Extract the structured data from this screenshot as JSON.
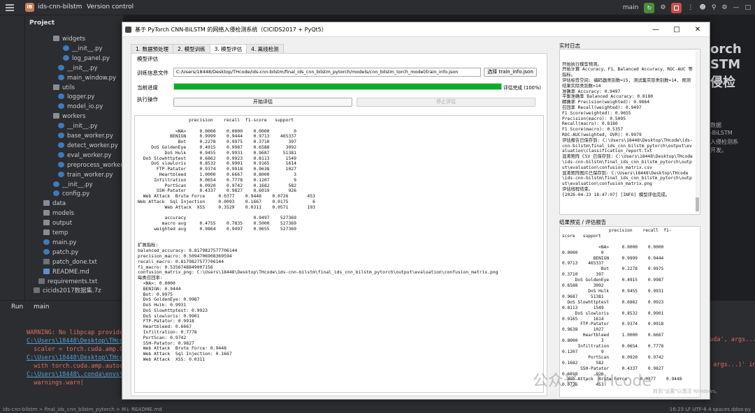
{
  "ide": {
    "project_badge": "IB",
    "project_name": "ids-cnn-bilstm",
    "version_control": "Version control",
    "branch": "main",
    "project_panel_title": "Project",
    "tree": [
      {
        "label": "widgets",
        "type": "folder",
        "indent": 2
      },
      {
        "label": "__init__.py",
        "type": "py",
        "indent": 4
      },
      {
        "label": "log_panel.py",
        "type": "py",
        "indent": 4
      },
      {
        "label": "__init__.py",
        "type": "py",
        "indent": 3
      },
      {
        "label": "main_window.py",
        "type": "py",
        "indent": 3
      },
      {
        "label": "utils",
        "type": "folder",
        "indent": 2
      },
      {
        "label": "logger.py",
        "type": "py",
        "indent": 3
      },
      {
        "label": "model_io.py",
        "type": "py",
        "indent": 3
      },
      {
        "label": "workers",
        "type": "folder",
        "indent": 2
      },
      {
        "label": "__init__.py",
        "type": "py",
        "indent": 3
      },
      {
        "label": "base_worker.py",
        "type": "py",
        "indent": 3
      },
      {
        "label": "detect_worker.py",
        "type": "py",
        "indent": 3
      },
      {
        "label": "eval_worker.py",
        "type": "py",
        "indent": 3
      },
      {
        "label": "preprocess_worker.py",
        "type": "py",
        "indent": 3
      },
      {
        "label": "train_worker.py",
        "type": "py",
        "indent": 3
      },
      {
        "label": "__init__.py",
        "type": "py",
        "indent": 2
      },
      {
        "label": "config.py",
        "type": "py",
        "indent": 2
      },
      {
        "label": "data",
        "type": "folder",
        "indent": 0
      },
      {
        "label": "models",
        "type": "folder",
        "indent": 0
      },
      {
        "label": "output",
        "type": "folder",
        "indent": 0
      },
      {
        "label": "temp",
        "type": "folder",
        "indent": 0
      },
      {
        "label": "main.py",
        "type": "py",
        "indent": 0
      },
      {
        "label": "patch.py",
        "type": "py",
        "indent": 0
      },
      {
        "label": "patch_done.txt",
        "type": "txt",
        "indent": 0
      },
      {
        "label": "README.md",
        "type": "md",
        "indent": 0
      },
      {
        "label": "requirements.txt",
        "type": "txt",
        "indent": -1
      },
      {
        "label": "cicids2017数据集.7z",
        "type": "txt",
        "indent": -2
      }
    ],
    "run_label": "Run",
    "run_tab": "main",
    "run_output": [
      {
        "cls": "w",
        "text": "WARNING: No libpcap provider"
      },
      {
        "cls": "l",
        "text": "C:\\Users\\18448\\Desktop\\THcode"
      },
      {
        "cls": "w",
        "text": "  scaler = torch.cuda.amp.Gra"
      },
      {
        "cls": "l",
        "text": "C:\\Users\\18448\\Desktop\\THcode"
      },
      {
        "cls": "w",
        "text": "  with torch.cuda.amp.autocas"
      },
      {
        "cls": "l",
        "text": "C:\\Users\\18448\\.conda\\envs\\d"
      },
      {
        "cls": "w",
        "text": "  warnings.warn("
      }
    ],
    "run_output_right": "cuda', args...\n\n\n, args...)' in",
    "status_left": "ids-cnn-bilstm  >  final_ids_cnn_bilstm_pytorch  >  M↓ README.md",
    "status_right": "16:23   LF   UTF-8   4 spaces   ddos-py",
    "bg_right_text": [
      "orch",
      "STM",
      "侵检",
      "",
      "",
      "",
      "",
      "数据",
      "-BiLSTM",
      "入侵检测系",
      "开发。"
    ]
  },
  "window": {
    "title": "基于 PyTorch CNN-BiLSTM 的网络入侵检测系统（CICIDS2017 + PyQt5）",
    "tabs": [
      "1. 数据预处理",
      "2. 模型训练",
      "3. 模型评估",
      "4. 离线检测"
    ],
    "active_tab": 2,
    "group_title": "模型评估",
    "train_info_label": "训练信息文件",
    "train_info_path": "C:/Users/18448/Desktop/THcode/ids-cnn-bilstm/final_ids_cnn_bilstm_pytorch/models/cnn_bilstm_torch_model/train_info.json",
    "choose_button": "选择 train_info.json",
    "progress_label": "当前进度",
    "progress_value": 1.0,
    "progress_text": "评估完成 (100%)",
    "actions_label": "执行操作",
    "start_button": "开始评估",
    "stop_button": "停止评估",
    "report_text": "                   precision    recall  f1-score   support\n\n              <NA>     0.0000    0.0000    0.0000         0\n            BENIGN     0.9999    0.9444    0.9713    465337\n               Bot     0.2278    0.9975    0.3710       397\n     DoS GoldenEye     0.4915    0.9987    0.6588      3092\n          DoS Hulk     0.9455    0.9931    0.9687     51381\n  DoS Slowhttptest     0.6862    0.9923    0.8113      1549\n     DoS slowloris     0.8532    0.9901    0.9165      1614\n       FTP-Patator     0.9374    0.9918    0.9638      1027\n        Heartbleed     1.0000    0.6667    0.8000         3\n      Infiltration     0.0654    0.7778    0.1207         9\n          PortScan     0.0920    0.9742    0.1682       582\n       SSH-Patator     0.4337    0.9827    0.6019       926\n  Web Attack  Brute Force     0.0377    0.9448    0.0726       453\nWeb Attack  Sql Injection     0.0093    0.1667    0.0175         6\n          Web Attack  XSS     0.3529    0.0311    0.0571       193\n\n          accuracy                         0.9497    527369\n         macro avg     0.4755    0.7835    0.5000    527369\n      weighted avg     0.9864    0.9497    0.9655    527369\n\n\n扩展指标:\nbalanced_accuracy: 0.8179827577706144\nprecision_macro: 0.5094706908369594\nrecall_macro: 0.8179827577706144\nf1_macro: 0.5356748849007156\nconfusion_matrix_png: C:\\Users\\18448\\Desktop\\THcode\\ids-cnn-bilstm\\final_ids_cnn_bilstm_pytorch\\output\\evaluation\\confusion_matrix.png\n每类召回率:\n  <NA>: 0.0000\n  BENIGN: 0.9444\n  Bot: 0.9975\n  DoS GoldenEye: 0.9987\n  DoS Hulk: 0.9931\n  DoS Slowhttptest: 0.9923\n  DoS slowloris: 0.9901\n  FTP-Patator: 0.9918\n  Heartbleed: 0.6667\n  Infiltration: 0.7778\n  PortScan: 0.9742\n  SSH-Patator: 0.9827\n  Web Attack  Brute Force: 0.9448\n  Web Attack  Sql Injection: 0.1667\n  Web Attack  XSS: 0.0311",
    "log_title": "实时日志",
    "log_text": "开始执行模型预测。\n开始计算 Accuracy、F1、Balanced Accuracy、ROC-AUC 等指标。\n评估标签空间: 编码器类别数=15, 测试集实际类别数=14, 预测结果实际类别数=14\n准确率 Accuracy: 0.9497\n平衡准确率 Balanced Accuracy: 0.8180\n精确率 Precision(weighted): 0.9864\n召回率 Recall(weighted): 0.9497\nF1 Score(weighted): 0.9655\nPrecision(macro): 0.5095\nRecall(macro): 0.8180\nF1 Score(macro): 0.5357\nROC-AUC(weighted, OVR): 0.9979\n评估报告已保存到: C:\\Users\\18448\\Desktop\\THcode\\ids-cnn-bilstm\\final_ids_cnn_bilstm_pytorch\\output\\evaluation\\classification_report.txt\n混淆矩阵 CSV 已保存到: C:\\Users\\18448\\Desktop\\THcode\\ids-cnn-bilstm\\final_ids_cnn_bilstm_pytorch\\output\\evaluation\\confusion_matrix.csv\n混淆矩阵图片已保存到: C:\\Users\\18448\\Desktop\\THcode\\ids-cnn-bilstm\\final_ids_cnn_bilstm_pytorch\\output\\evaluation\\confusion_matrix.png\n评估线程结束。\n[2026-04-23 18:47:07] [INFO] 模型评估完成。",
    "result_title": "结果预览 / 评估报告",
    "result_text": "                  precision    recall  f1-\nscore   support\n\n              <NA>     0.0000    0.0000\n0.0000         0\n            BENIGN     0.9999    0.9444\n0.9713    465337\n               Bot     0.2278    0.9975\n0.3710       397\n     DoS GoldenEye     0.4915    0.9987\n0.6588      3092\n          DoS Hulk     0.9455    0.9931\n0.9687     51381\n  DoS Slowhttptest     0.6862    0.9923\n0.8113      1549\n     DoS slowloris     0.8532    0.9901\n0.9165      1614\n       FTP-Patator     0.9374    0.9918\n0.9638      1027\n        Heartbleed     1.0000    0.6667\n0.8000         3\n      Infiltration     0.0654    0.7778\n0.1207         9\n          PortScan     0.0920    0.9742\n0.1682       582\n       SSH-Patator     0.4337    0.9827\n0.6019       926\n  Web Attack  Brute Force     0.0377    0.9448\n0.0726       453",
    "watermark": "公众号 · THcode",
    "watermark2": "转到\"设置\"以激活 Windows。"
  }
}
